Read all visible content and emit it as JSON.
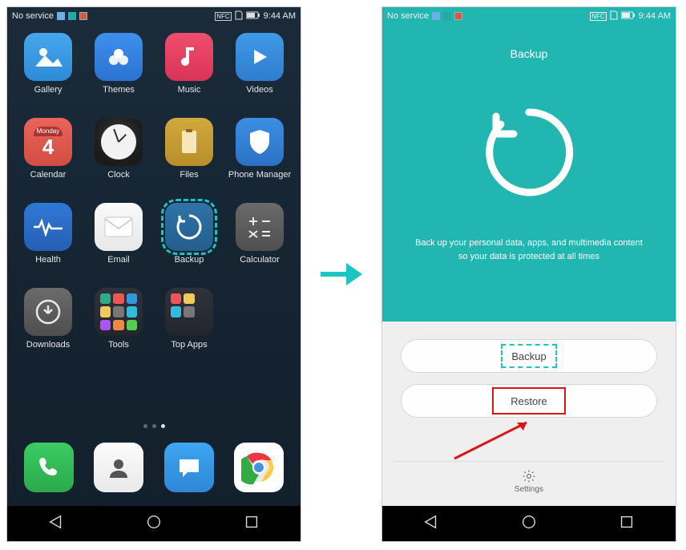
{
  "status": {
    "no_service": "No service",
    "time": "9:44 AM"
  },
  "home": {
    "apps": [
      {
        "label": "Gallery"
      },
      {
        "label": "Themes"
      },
      {
        "label": "Music"
      },
      {
        "label": "Videos"
      },
      {
        "label": "Calendar",
        "day_name": "Monday",
        "day_num": "4"
      },
      {
        "label": "Clock"
      },
      {
        "label": "Files"
      },
      {
        "label": "Phone Manager"
      },
      {
        "label": "Health"
      },
      {
        "label": "Email"
      },
      {
        "label": "Backup"
      },
      {
        "label": "Calculator"
      },
      {
        "label": "Downloads"
      },
      {
        "label": "Tools"
      },
      {
        "label": "Top Apps"
      }
    ]
  },
  "backup_screen": {
    "title": "Backup",
    "desc_line1": "Back up your personal data, apps, and multimedia content",
    "desc_line2": "so your data is protected at all times",
    "backup_btn": "Backup",
    "restore_btn": "Restore",
    "settings": "Settings"
  }
}
